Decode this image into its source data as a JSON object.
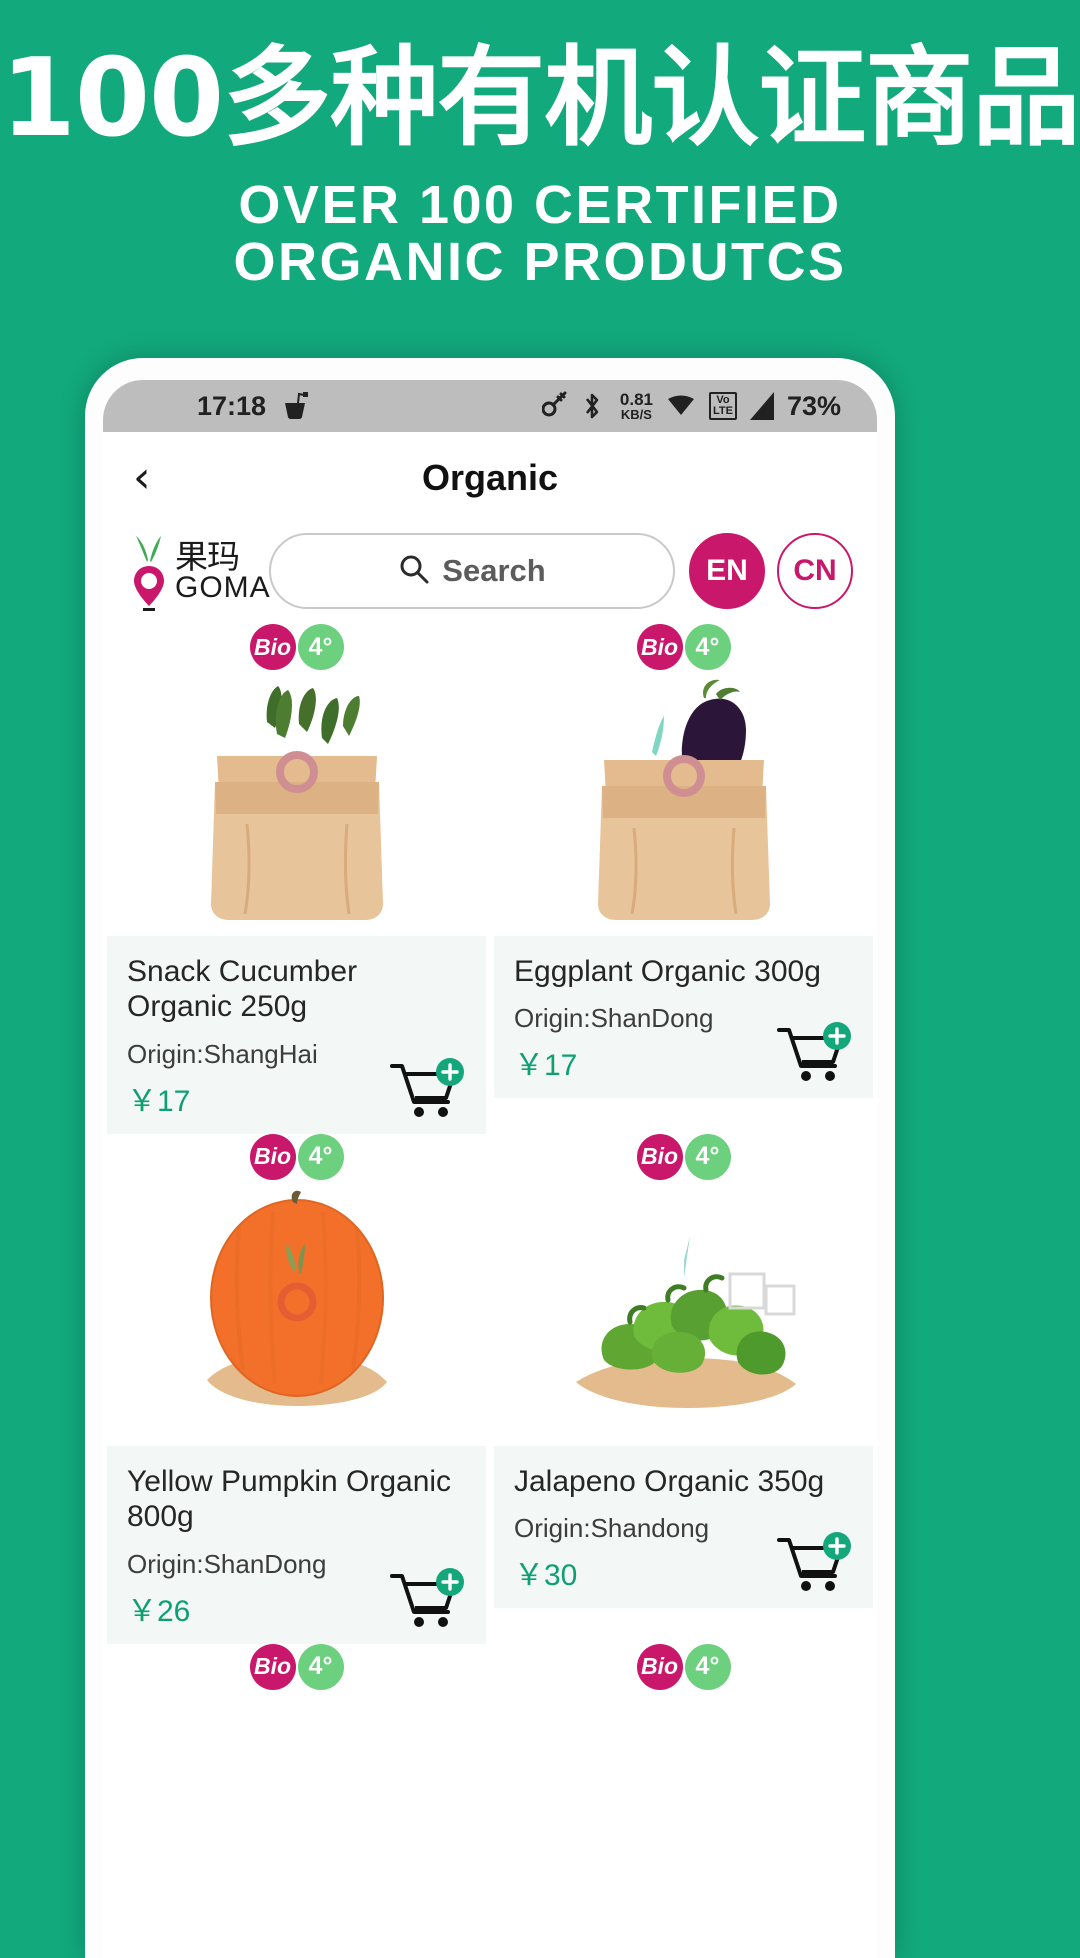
{
  "promo": {
    "headline_cn": "100多种有机认证商品",
    "headline_en_line1": "OVER 100 CERTIFIED",
    "headline_en_line2": "ORGANIC PRODUTCS",
    "background_color": "#12a97c"
  },
  "statusbar": {
    "time": "17:18",
    "cup_icon": "cup-icon",
    "key_icon": "key-icon",
    "bluetooth_icon": "bluetooth-icon",
    "speed_value": "0.81",
    "speed_unit": "KB/S",
    "wifi_icon": "wifi-icon",
    "volte_top": "Vo",
    "volte_bottom": "LTE",
    "signal_icon": "signal-icon",
    "battery": "73%"
  },
  "appbar": {
    "back_icon": "back-chevron-icon",
    "title": "Organic"
  },
  "brand": {
    "logo_icon": "goma-sprout-pin-icon",
    "name_cn": "果玛",
    "name_en": "GOMA"
  },
  "search": {
    "icon": "search-icon",
    "placeholder": "Search"
  },
  "language": {
    "active": "EN",
    "inactive": "CN"
  },
  "badges": {
    "bio_label": "Bio",
    "temp_label": "4°",
    "bio_color": "#c9176b",
    "temp_color": "#6cd07f"
  },
  "products": [
    {
      "image": "snack-cucumber-in-paper-bag",
      "name": "Snack Cucumber Organic 250g",
      "origin": "Origin:ShangHai",
      "price": "￥17",
      "bio": "Bio",
      "temp": "4°",
      "cart_icon": "add-to-cart-icon"
    },
    {
      "image": "eggplant-in-paper-bag",
      "name": "Eggplant Organic 300g",
      "origin": "Origin:ShanDong",
      "price": "￥17",
      "bio": "Bio",
      "temp": "4°",
      "cart_icon": "add-to-cart-icon"
    },
    {
      "image": "yellow-pumpkin-on-paper",
      "name": "Yellow Pumpkin Organic 800g",
      "origin": "Origin:ShanDong",
      "price": "￥26",
      "bio": "Bio",
      "temp": "4°",
      "cart_icon": "add-to-cart-icon"
    },
    {
      "image": "jalapeno-peppers-on-paper",
      "name": "Jalapeno Organic 350g",
      "origin": "Origin:Shandong",
      "price": "￥30",
      "bio": "Bio",
      "temp": "4°",
      "cart_icon": "add-to-cart-icon"
    }
  ],
  "partial_row": {
    "bio": "Bio",
    "temp": "4°"
  },
  "colors": {
    "brand_green": "#12a97c",
    "accent_magenta": "#c9176b",
    "price_green": "#0e9f72",
    "badge_green": "#6cd07f"
  }
}
